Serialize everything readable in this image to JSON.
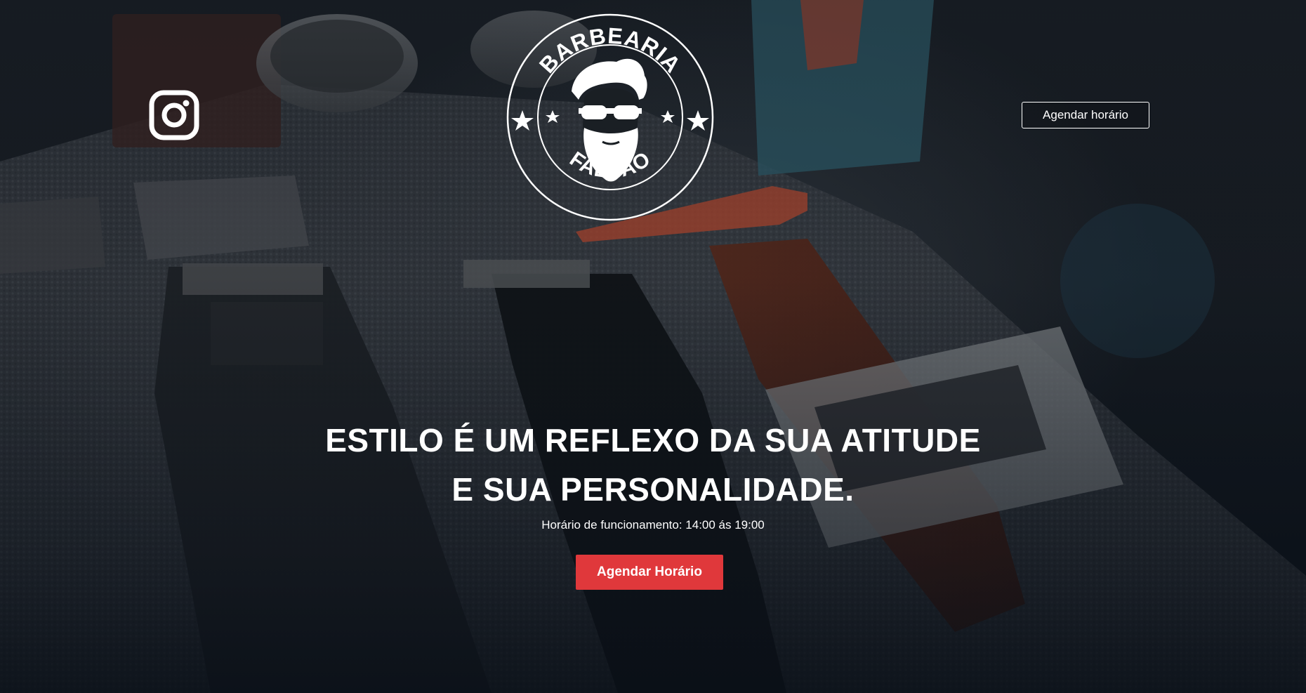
{
  "brand": {
    "name_top": "BARBEARIA",
    "name_bottom": "FALCÃO",
    "logo_icon": "bearded-man-with-sunglasses"
  },
  "social": {
    "instagram_icon": "instagram-icon"
  },
  "header": {
    "cta_label": "Agendar horário"
  },
  "hero": {
    "headline_line1": "ESTILO É UM REFLEXO DA SUA ATITUDE",
    "headline_line2": "E SUA PERSONALIDADE.",
    "hours_text": "Horário de funcionamento: 14:00 ás 19:00",
    "cta_label": "Agendar Horário"
  },
  "colors": {
    "accent": "#e0383b",
    "text": "#ffffff",
    "background": "#0d141c"
  }
}
